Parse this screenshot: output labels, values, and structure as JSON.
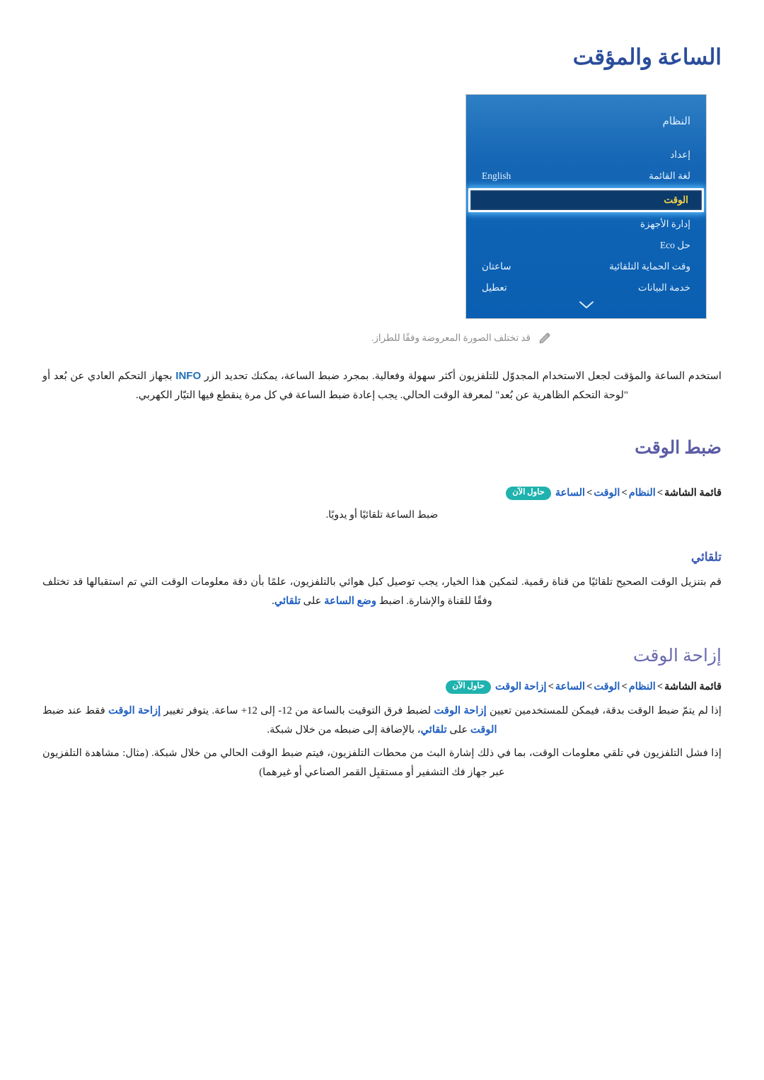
{
  "document": {
    "title": "الساعة والمؤقت",
    "language": "ar"
  },
  "figure": {
    "caption": "قد تختلف الصورة المعروضة وفقًا للطراز.",
    "pencil_icon": "pencil-icon",
    "tv_menu": {
      "header": "النظام",
      "chevron_icon": "chevron-down-icon",
      "rows": [
        {
          "label": "إعداد",
          "value": ""
        },
        {
          "label": "لغة القائمة",
          "value": "English"
        },
        {
          "label": "الوقت",
          "value": "",
          "selected": true
        },
        {
          "label": "إدارة الأجهزة",
          "value": ""
        },
        {
          "label": "حل Eco",
          "value": ""
        },
        {
          "label": "وقت الحماية التلقائية",
          "value": "ساعتان"
        },
        {
          "label": "خدمة البيانات",
          "value": "تعطيل"
        }
      ]
    }
  },
  "intro": {
    "text_part1": "استخدم الساعة والمؤقت لجعل الاستخدام المجدوّل للتلفزيون أكثر سهولة وفعالية. بمجرد ضبط الساعة، يمكنك تحديد الزر ",
    "info_key": "INFO",
    "text_part2": " بجهاز التحكم العادي عن بُعد أو \"لوحة التحكم الظاهرية عن بُعد\" لمعرفة الوقت الحالي. يجب إعادة ضبط الساعة في كل مرة ينقطع فيها التيّار الكهربي."
  },
  "sections": [
    {
      "heading": "ضبط الوقت",
      "breadcrumb": {
        "root": "قائمة الشاشة",
        "links": [
          "النظام",
          "الوقت",
          "الساعة"
        ],
        "separator": ">",
        "badge": "حاول الآن"
      },
      "note": "ضبط الساعة تلقائيًا أو يدويًا.",
      "subsection": {
        "heading": "تلقائي",
        "text_part1": "قم بتنزيل الوقت الصحيح تلقائيًا من قناة رقمية. لتمكين هذا الخيار، يجب توصيل كبل هوائي بالتلفزيون، علمًا بأن دقة معلومات الوقت التي تم استقبالها قد تختلف وفقًا للقناة والإشارة. اضبط ",
        "emphasis1": "وضع الساعة",
        "text_part2": " على ",
        "emphasis2": "تلقائي",
        "text_part3": "."
      }
    },
    {
      "heading": "إزاحة الوقت",
      "breadcrumb": {
        "root": "قائمة الشاشة",
        "links": [
          "النظام",
          "الوقت",
          "الساعة",
          "إزاحة الوقت"
        ],
        "separator": ">",
        "badge": "حاول الآن"
      },
      "paragraphs": {
        "offset_part1": "إذا لم يتمّ ضبط الوقت بدقة، فيمكن للمستخدمين تعيين ",
        "offset_em1": "إزاحة الوقت",
        "offset_part2": " لضبط فرق التوقيت بالساعة من 12- إلى 12+ ساعة. يتوفر تغيير ",
        "offset_em2": "إزاحة الوقت",
        "offset_part3": " فقط عند ضبط ",
        "offset_em3": "الوقت",
        "offset_part4": " على ",
        "offset_em4": "تلقائي",
        "offset_part5": "، بالإضافة إلى ضبطه من خلال شبكة.",
        "network": "إذا فشل التلفزيون في تلقي معلومات الوقت، بما في ذلك إشارة البث من محطات التلفزيون، فيتم ضبط الوقت الحالي من خلال شبكة. (مثال: مشاهدة التلفزيون عبر جهاز فك التشفير أو مستقبِل القمر الصناعي أو غيرهما)"
      }
    }
  ],
  "colors": {
    "title_blue": "#2a4d9b",
    "heading_purple": "#5b5ba6",
    "subheading_blue": "#3b59b5",
    "link_blue": "#1f5fc0",
    "badge_teal": "#1fb2ae",
    "panel_blue": "#0f63b4",
    "selected_row": "#0c3a6b",
    "selected_text": "#f2d24b"
  }
}
